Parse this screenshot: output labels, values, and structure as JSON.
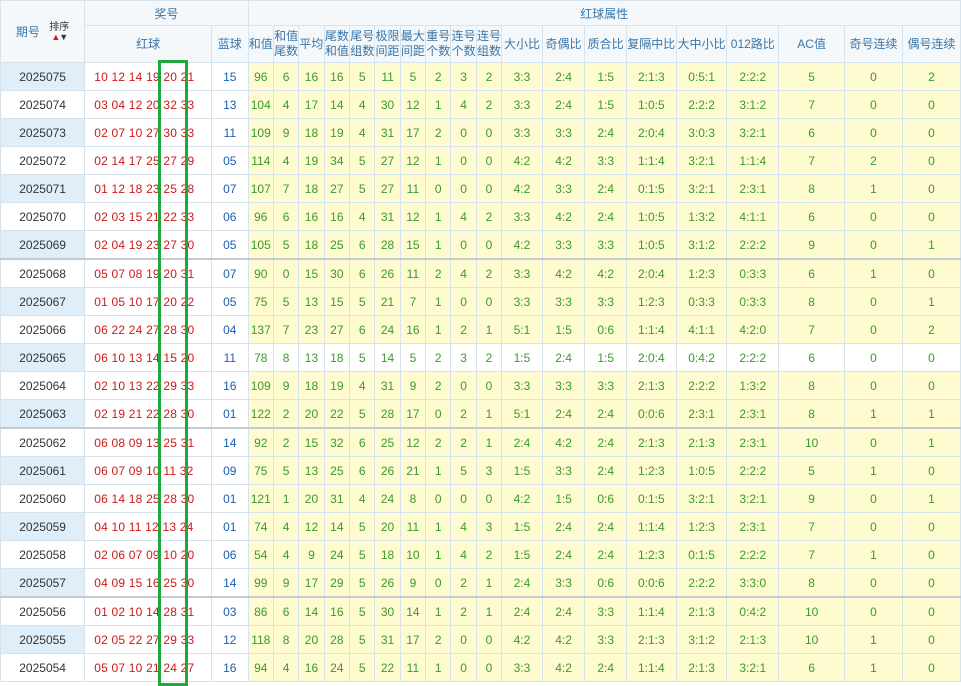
{
  "header": {
    "period_label": "期号",
    "sort_label": "排序",
    "prize_group": "奖号",
    "red_attr_group": "红球属性",
    "red_ball": "红球",
    "blue_ball": "蓝球",
    "cols": [
      "和值",
      "和值尾数",
      "平均值",
      "尾数和值",
      "尾号组数",
      "极限间距",
      "最大间距",
      "重号个数",
      "连号个数",
      "连号组数",
      "大小比",
      "奇偶比",
      "质合比",
      "复隔中比",
      "大中小比",
      "012路比",
      "AC值",
      "奇号连续",
      "偶号连续"
    ]
  },
  "highlight_color": "#1fa83c",
  "rows": [
    {
      "period": "2025075",
      "red": "10 12 14 19 20 21",
      "blue": "15",
      "attrs": [
        "96",
        "6",
        "16",
        "16",
        "5",
        "11",
        "5",
        "2",
        "3",
        "2",
        "3:3",
        "2:4",
        "1:5",
        "2:1:3",
        "0:5:1",
        "2:2:2",
        "5",
        "0",
        "2"
      ]
    },
    {
      "period": "2025074",
      "red": "03 04 12 20 32 33",
      "blue": "13",
      "attrs": [
        "104",
        "4",
        "17",
        "14",
        "4",
        "30",
        "12",
        "1",
        "4",
        "2",
        "3:3",
        "2:4",
        "1:5",
        "1:0:5",
        "2:2:2",
        "3:1:2",
        "7",
        "0",
        "0"
      ]
    },
    {
      "period": "2025073",
      "red": "02 07 10 27 30 33",
      "blue": "11",
      "attrs": [
        "109",
        "9",
        "18",
        "19",
        "4",
        "31",
        "17",
        "2",
        "0",
        "0",
        "3:3",
        "3:3",
        "2:4",
        "2:0:4",
        "3:0:3",
        "3:2:1",
        "6",
        "0",
        "0"
      ]
    },
    {
      "period": "2025072",
      "red": "02 14 17 25 27 29",
      "blue": "05",
      "attrs": [
        "114",
        "4",
        "19",
        "34",
        "5",
        "27",
        "12",
        "1",
        "0",
        "0",
        "4:2",
        "4:2",
        "3:3",
        "1:1:4",
        "3:2:1",
        "1:1:4",
        "7",
        "2",
        "0"
      ]
    },
    {
      "period": "2025071",
      "red": "01 12 18 23 25 28",
      "blue": "07",
      "attrs": [
        "107",
        "7",
        "18",
        "27",
        "5",
        "27",
        "11",
        "0",
        "0",
        "0",
        "4:2",
        "3:3",
        "2:4",
        "0:1:5",
        "3:2:1",
        "2:3:1",
        "8",
        "1",
        "0"
      ]
    },
    {
      "period": "2025070",
      "red": "02 03 15 21 22 33",
      "blue": "06",
      "attrs": [
        "96",
        "6",
        "16",
        "16",
        "4",
        "31",
        "12",
        "1",
        "4",
        "2",
        "3:3",
        "4:2",
        "2:4",
        "1:0:5",
        "1:3:2",
        "4:1:1",
        "6",
        "0",
        "0"
      ]
    },
    {
      "period": "2025069",
      "red": "02 04 19 23 27 30",
      "blue": "05",
      "attrs": [
        "105",
        "5",
        "18",
        "25",
        "6",
        "28",
        "15",
        "1",
        "0",
        "0",
        "4:2",
        "3:3",
        "3:3",
        "1:0:5",
        "3:1:2",
        "2:2:2",
        "9",
        "0",
        "1"
      ]
    },
    {
      "period": "2025068",
      "red": "05 07 08 19 20 31",
      "blue": "07",
      "attrs": [
        "90",
        "0",
        "15",
        "30",
        "6",
        "26",
        "11",
        "2",
        "4",
        "2",
        "3:3",
        "4:2",
        "4:2",
        "2:0:4",
        "1:2:3",
        "0:3:3",
        "6",
        "1",
        "0"
      ]
    },
    {
      "period": "2025067",
      "red": "01 05 10 17 20 22",
      "blue": "05",
      "attrs": [
        "75",
        "5",
        "13",
        "15",
        "5",
        "21",
        "7",
        "1",
        "0",
        "0",
        "3:3",
        "3:3",
        "3:3",
        "1:2:3",
        "0:3:3",
        "0:3:3",
        "8",
        "0",
        "1"
      ]
    },
    {
      "period": "2025066",
      "red": "06 22 24 27 28 30",
      "blue": "04",
      "attrs": [
        "137",
        "7",
        "23",
        "27",
        "6",
        "24",
        "16",
        "1",
        "2",
        "1",
        "5:1",
        "1:5",
        "0:6",
        "1:1:4",
        "4:1:1",
        "4:2:0",
        "7",
        "0",
        "2"
      ]
    },
    {
      "period": "2025065",
      "red": "06 10 13 14 15 20",
      "blue": "11",
      "attrs": [
        "78",
        "8",
        "13",
        "18",
        "5",
        "14",
        "5",
        "2",
        "3",
        "2",
        "1:5",
        "2:4",
        "1:5",
        "2:0:4",
        "0:4:2",
        "2:2:2",
        "6",
        "0",
        "0"
      ]
    },
    {
      "period": "2025064",
      "red": "02 10 13 22 29 33",
      "blue": "16",
      "attrs": [
        "109",
        "9",
        "18",
        "19",
        "4",
        "31",
        "9",
        "2",
        "0",
        "0",
        "3:3",
        "3:3",
        "3:3",
        "2:1:3",
        "2:2:2",
        "1:3:2",
        "8",
        "0",
        "0"
      ]
    },
    {
      "period": "2025063",
      "red": "02 19 21 22 28 30",
      "blue": "01",
      "attrs": [
        "122",
        "2",
        "20",
        "22",
        "5",
        "28",
        "17",
        "0",
        "2",
        "1",
        "5:1",
        "2:4",
        "2:4",
        "0:0:6",
        "2:3:1",
        "2:3:1",
        "8",
        "1",
        "1"
      ]
    },
    {
      "period": "2025062",
      "red": "06 08 09 13 25 31",
      "blue": "14",
      "attrs": [
        "92",
        "2",
        "15",
        "32",
        "6",
        "25",
        "12",
        "2",
        "2",
        "1",
        "2:4",
        "4:2",
        "2:4",
        "2:1:3",
        "2:1:3",
        "2:3:1",
        "10",
        "0",
        "1"
      ]
    },
    {
      "period": "2025061",
      "red": "06 07 09 10 11 32",
      "blue": "09",
      "attrs": [
        "75",
        "5",
        "13",
        "25",
        "6",
        "26",
        "21",
        "1",
        "5",
        "3",
        "1:5",
        "3:3",
        "2:4",
        "1:2:3",
        "1:0:5",
        "2:2:2",
        "5",
        "1",
        "0"
      ]
    },
    {
      "period": "2025060",
      "red": "06 14 18 25 28 30",
      "blue": "01",
      "attrs": [
        "121",
        "1",
        "20",
        "31",
        "4",
        "24",
        "8",
        "0",
        "0",
        "0",
        "4:2",
        "1:5",
        "0:6",
        "0:1:5",
        "3:2:1",
        "3:2:1",
        "9",
        "0",
        "1"
      ]
    },
    {
      "period": "2025059",
      "red": "04 10 11 12 13 24",
      "blue": "01",
      "attrs": [
        "74",
        "4",
        "12",
        "14",
        "5",
        "20",
        "11",
        "1",
        "4",
        "3",
        "1:5",
        "2:4",
        "2:4",
        "1:1:4",
        "1:2:3",
        "2:3:1",
        "7",
        "0",
        "0"
      ]
    },
    {
      "period": "2025058",
      "red": "02 06 07 09 10 20",
      "blue": "06",
      "attrs": [
        "54",
        "4",
        "9",
        "24",
        "5",
        "18",
        "10",
        "1",
        "4",
        "2",
        "1:5",
        "2:4",
        "2:4",
        "1:2:3",
        "0:1:5",
        "2:2:2",
        "7",
        "1",
        "0"
      ]
    },
    {
      "period": "2025057",
      "red": "04 09 15 16 25 30",
      "blue": "14",
      "attrs": [
        "99",
        "9",
        "17",
        "29",
        "5",
        "26",
        "9",
        "0",
        "2",
        "1",
        "2:4",
        "3:3",
        "0:6",
        "0:0:6",
        "2:2:2",
        "3:3:0",
        "8",
        "0",
        "0"
      ]
    },
    {
      "period": "2025056",
      "red": "01 02 10 14 28 31",
      "blue": "03",
      "attrs": [
        "86",
        "6",
        "14",
        "16",
        "5",
        "30",
        "14",
        "1",
        "2",
        "1",
        "2:4",
        "2:4",
        "3:3",
        "1:1:4",
        "2:1:3",
        "0:4:2",
        "10",
        "0",
        "0"
      ]
    },
    {
      "period": "2025055",
      "red": "02 05 22 27 29 33",
      "blue": "12",
      "attrs": [
        "118",
        "8",
        "20",
        "28",
        "5",
        "31",
        "17",
        "2",
        "0",
        "0",
        "4:2",
        "4:2",
        "3:3",
        "2:1:3",
        "3:1:2",
        "2:1:3",
        "10",
        "1",
        "0"
      ]
    },
    {
      "period": "2025054",
      "red": "05 07 10 21 24 27",
      "blue": "16",
      "attrs": [
        "94",
        "4",
        "16",
        "24",
        "5",
        "22",
        "11",
        "1",
        "0",
        "0",
        "3:3",
        "4:2",
        "2:4",
        "1:1:4",
        "2:1:3",
        "3:2:1",
        "6",
        "1",
        "0"
      ]
    }
  ]
}
